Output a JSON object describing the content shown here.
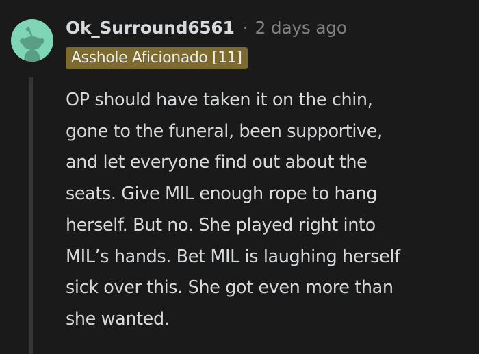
{
  "comment": {
    "username": "Ok_Surround6561",
    "separator": "·",
    "timestamp": "2 days ago",
    "flair": "Asshole Aficionado [11]",
    "avatar_icon": "snoo-avatar-icon",
    "body_lines": [
      "OP should have taken it on the chin,",
      "gone to the funeral, been supportive,",
      "and let everyone find out about the",
      "seats. Give MIL enough rope to hang",
      "herself. But no. She played right into",
      "MIL’s hands. Bet MIL is laughing herself",
      "sick over this. She got even more than",
      "she wanted."
    ]
  },
  "colors": {
    "background": "#1a1a1b",
    "text": "#d7dadc",
    "muted": "#818384",
    "avatar_bg": "#7ed6b6",
    "flair_bg": "#7c6a2f",
    "thread_line": "#343536"
  }
}
